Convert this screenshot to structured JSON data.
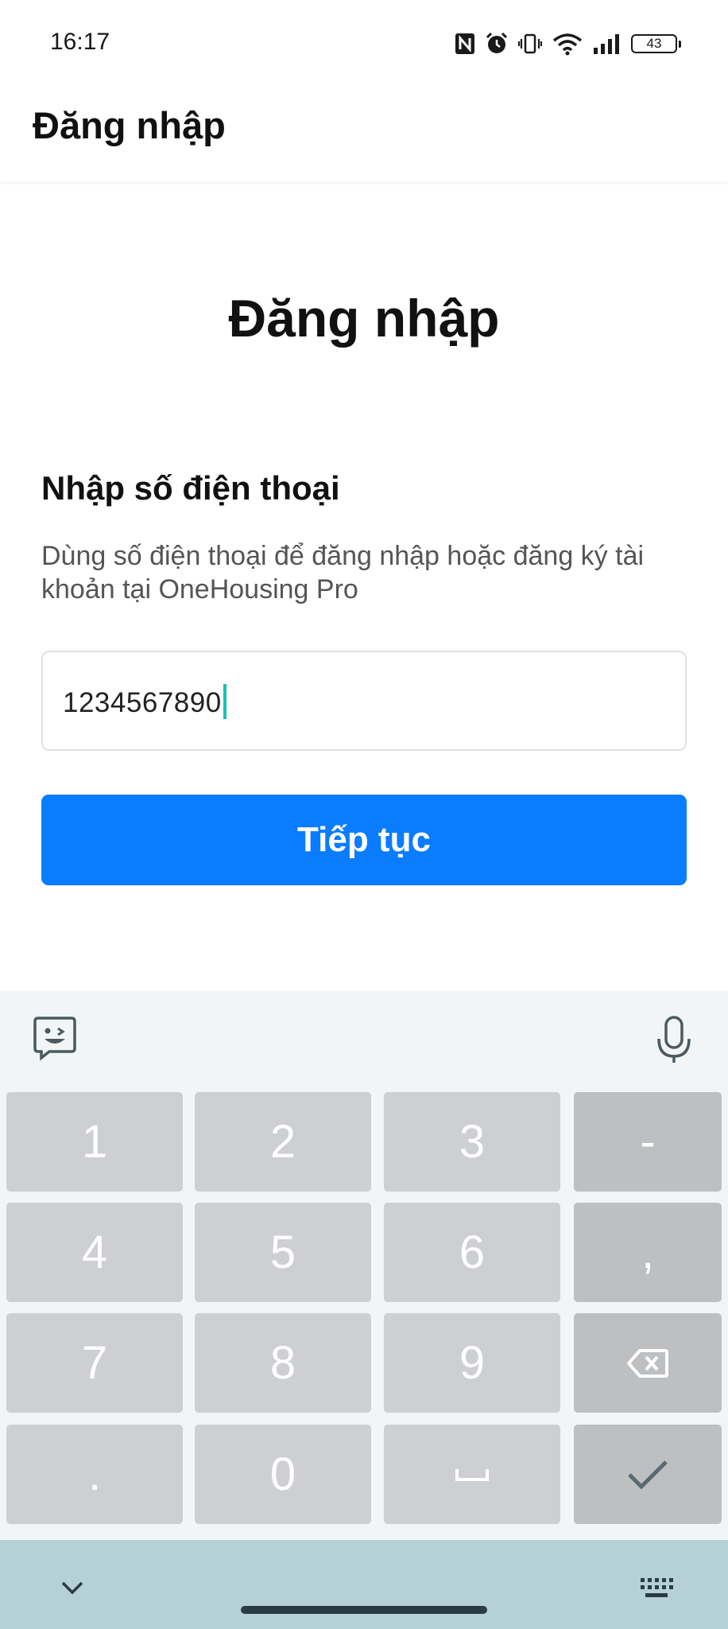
{
  "status_bar": {
    "time": "16:17",
    "battery_level": "43",
    "icons": [
      "nfc-icon",
      "alarm-icon",
      "vibrate-icon",
      "wifi-icon",
      "signal-icon",
      "battery-icon"
    ]
  },
  "app_bar": {
    "title": "Đăng nhập"
  },
  "main": {
    "heading": "Đăng nhập",
    "section_title": "Nhập số điện thoại",
    "description": "Dùng số điện thoại để đăng nhập hoặc đăng ký tài khoản tại OneHousing Pro",
    "phone_input": {
      "value": "1234567890"
    },
    "continue_label": "Tiếp tục"
  },
  "keyboard": {
    "keys": [
      {
        "label": "1",
        "name": "key-1"
      },
      {
        "label": "2",
        "name": "key-2"
      },
      {
        "label": "3",
        "name": "key-3"
      },
      {
        "label": "-",
        "name": "key-minus"
      },
      {
        "label": "4",
        "name": "key-4"
      },
      {
        "label": "5",
        "name": "key-5"
      },
      {
        "label": "6",
        "name": "key-6"
      },
      {
        "label": ",",
        "name": "key-comma"
      },
      {
        "label": "7",
        "name": "key-7"
      },
      {
        "label": "8",
        "name": "key-8"
      },
      {
        "label": "9",
        "name": "key-9"
      },
      {
        "label": "",
        "name": "key-backspace",
        "icon": "backspace-icon"
      },
      {
        "label": ".",
        "name": "key-period"
      },
      {
        "label": "0",
        "name": "key-0"
      },
      {
        "label": "",
        "name": "key-space",
        "icon": "space-icon"
      },
      {
        "label": "",
        "name": "key-enter",
        "icon": "checkmark-icon"
      }
    ]
  },
  "colors": {
    "accent": "#0a7cff",
    "caret": "#19c1b4",
    "key_bg": "#cdcfd2",
    "func_key_bg": "#bdbfc1",
    "nav_bg": "#b5d0d6"
  }
}
